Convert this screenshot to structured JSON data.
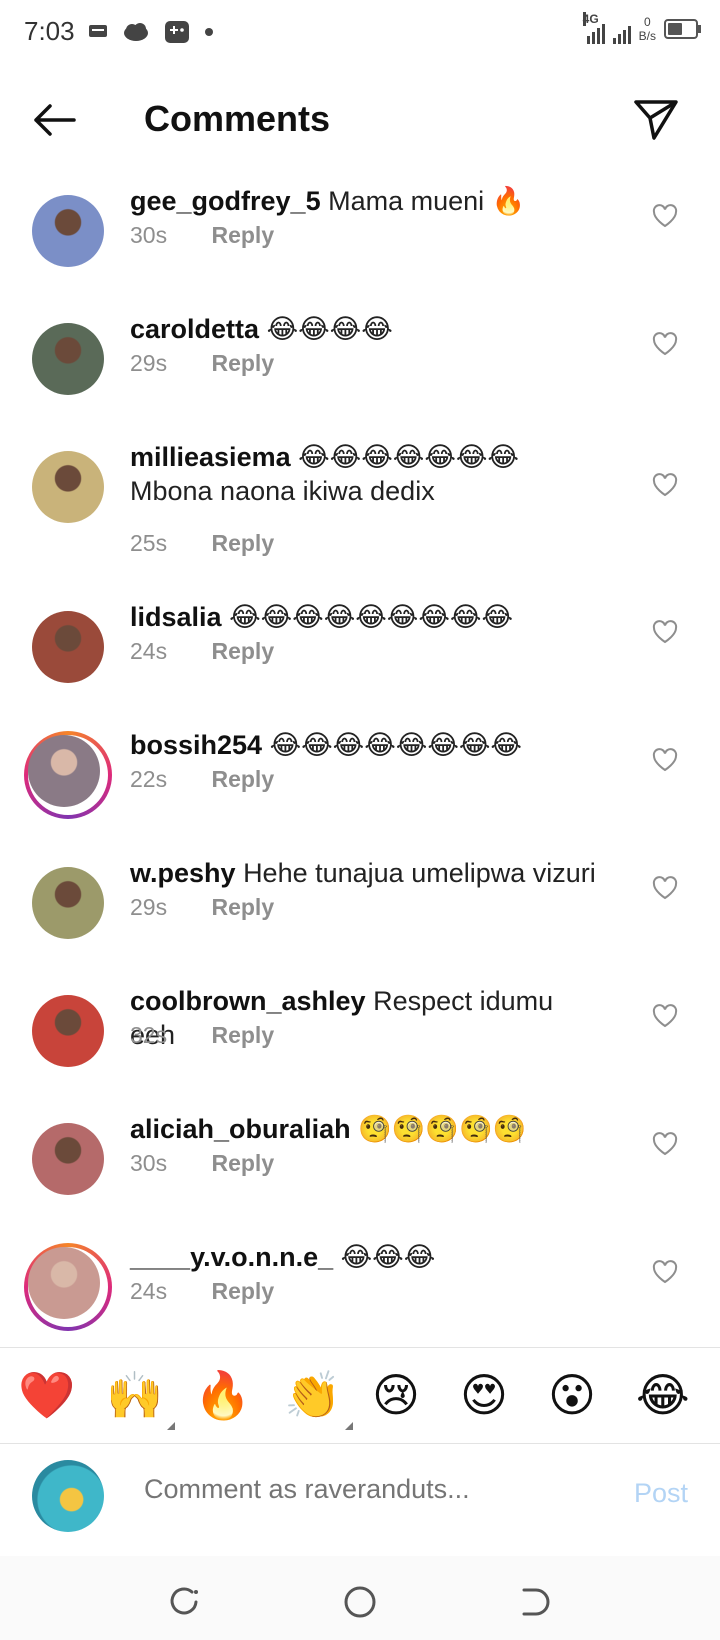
{
  "status_bar": {
    "time": "7:03",
    "network": "4G",
    "speed_value": "0",
    "speed_unit": "B/s",
    "icons": [
      "message-icon",
      "cloud-icon",
      "game-icon",
      "dot-icon",
      "signal-icon",
      "signal-icon",
      "battery-icon"
    ]
  },
  "header": {
    "title": "Comments",
    "back_icon": "arrow-left-icon",
    "send_icon": "paper-plane-icon"
  },
  "comments": [
    {
      "username": "gee_godfrey_5",
      "text": "Mama  mueni 🔥",
      "time": "30s",
      "reply": "Reply",
      "avatar_color": "#7b8fc7",
      "ring": false
    },
    {
      "username": "caroldetta",
      "text": "😂😂😂😂",
      "time": "29s",
      "reply": "Reply",
      "avatar_color": "#5a6a58",
      "ring": false
    },
    {
      "username": "millieasiema",
      "text": "😂😂😂😂😂😂😂 Mbona naona ikiwa dedix",
      "time": "25s",
      "reply": "Reply",
      "avatar_color": "#c9b37a",
      "ring": false
    },
    {
      "username": "lidsalia",
      "text": "😂😂😂😂😂😂😂😂😂",
      "time": "24s",
      "reply": "Reply",
      "avatar_color": "#9a4a3a",
      "ring": false
    },
    {
      "username": "bossih254",
      "text": "😂😂😂😂😂😂😂😂",
      "time": "22s",
      "reply": "Reply",
      "avatar_color": "#8a7a86",
      "ring": true
    },
    {
      "username": "w.peshy",
      "text": "Hehe tunajua umelipwa vizuri",
      "time": "29s",
      "reply": "Reply",
      "avatar_color": "#9c9a6a",
      "ring": false
    },
    {
      "username": "coolbrown_ashley",
      "text": "Respect idumu eeh",
      "time": "32s",
      "reply": "Reply",
      "avatar_color": "#c8443a",
      "ring": false
    },
    {
      "username": "aliciah_oburaliah",
      "text": "🧐🧐🧐🧐🧐",
      "time": "30s",
      "reply": "Reply",
      "avatar_color": "#b56a6a",
      "ring": false
    },
    {
      "username": "____y.v.o.n.n.e_",
      "text": "😂😂😂",
      "time": "24s",
      "reply": "Reply",
      "avatar_color": "#c99a92",
      "ring": true
    }
  ],
  "reactions": [
    "❤️",
    "🙌",
    "🔥",
    "👏",
    "😢",
    "😍",
    "😮",
    "😂"
  ],
  "composer": {
    "placeholder": "Comment as raveranduts...",
    "post_label": "Post"
  },
  "nav": [
    "recent-apps-icon",
    "home-icon",
    "back-nav-icon"
  ]
}
